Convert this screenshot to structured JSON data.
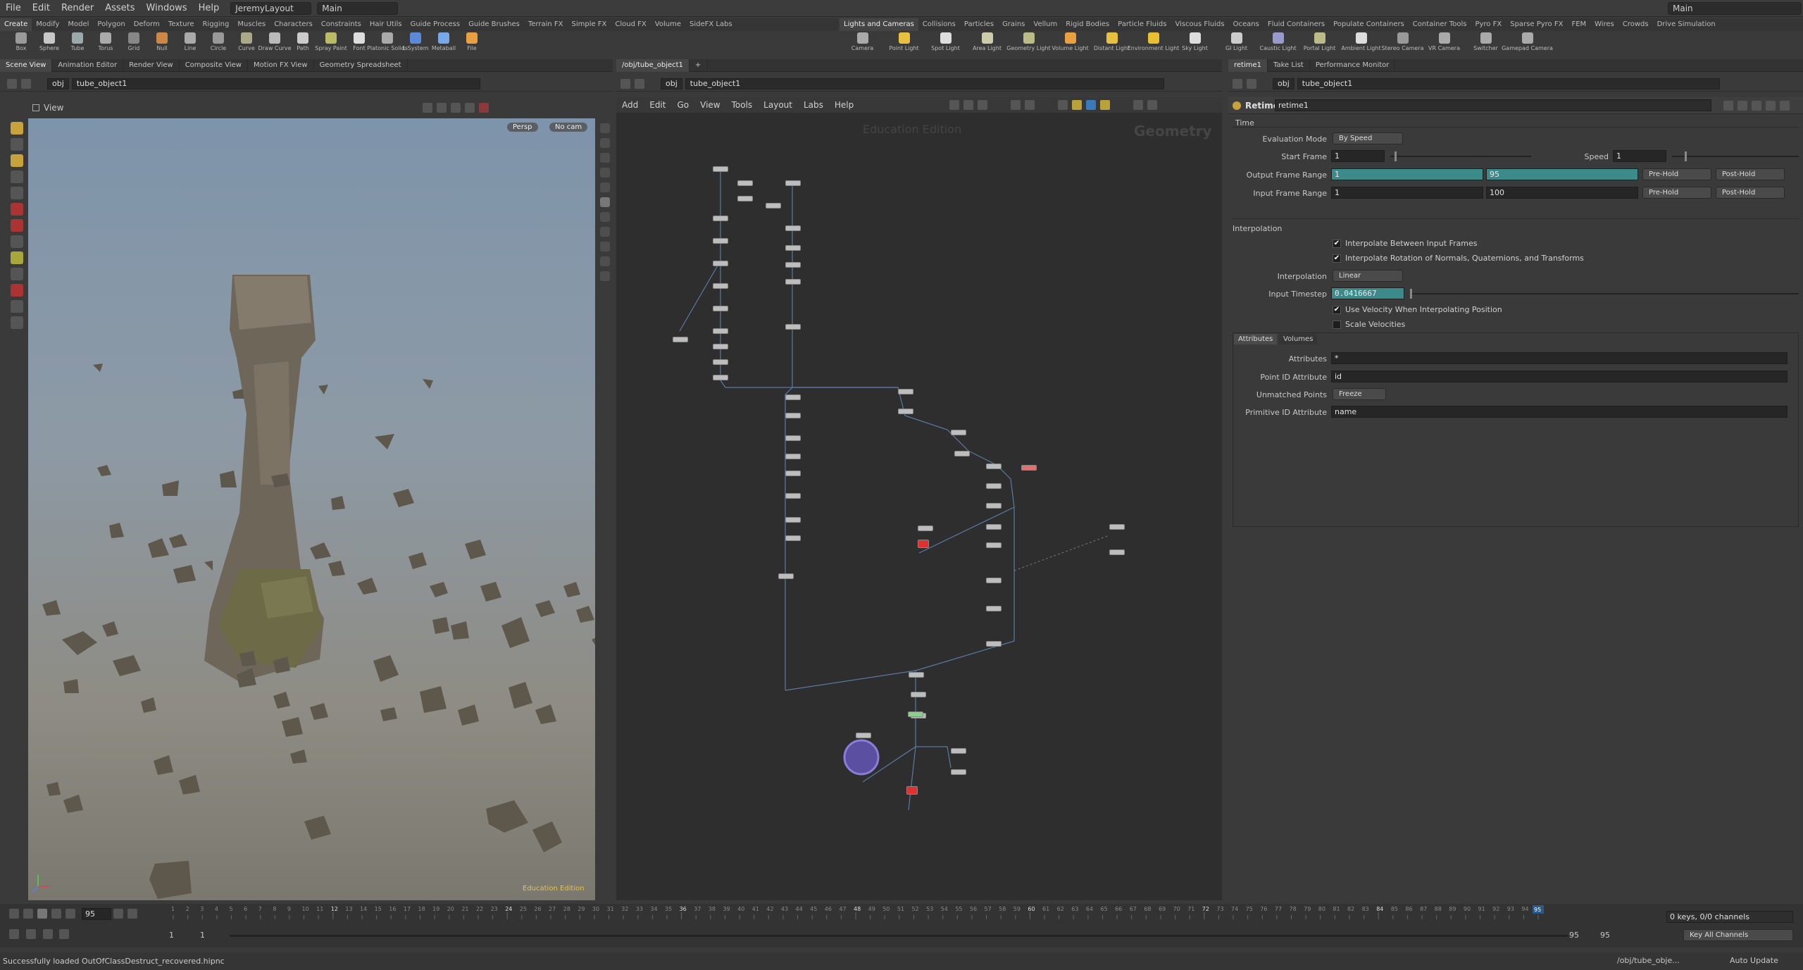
{
  "menubar": {
    "items": [
      "File",
      "Edit",
      "Render",
      "Assets",
      "Windows",
      "Help"
    ],
    "desktop": "JeremyLayout",
    "context": "Main",
    "right_context": "Main"
  },
  "shelf_left": {
    "tabs": [
      "Create",
      "Modify",
      "Model",
      "Polygon",
      "Deform",
      "Texture",
      "Rigging",
      "Muscles",
      "Characters",
      "Constraints",
      "Hair Utils",
      "Guide Process",
      "Guide Brushes",
      "Terrain FX",
      "Simple FX",
      "Cloud FX",
      "Volume",
      "SideFX Labs"
    ],
    "tools": [
      "Box",
      "Sphere",
      "Tube",
      "Torus",
      "Grid",
      "Null",
      "Line",
      "Circle",
      "Curve",
      "Draw Curve",
      "Path",
      "Spray Paint",
      "Font",
      "Platonic Solids",
      "L-System",
      "Metaball",
      "File"
    ]
  },
  "shelf_right": {
    "tabs": [
      "Lights and Cameras",
      "Collisions",
      "Particles",
      "Grains",
      "Vellum",
      "Rigid Bodies",
      "Particle Fluids",
      "Viscous Fluids",
      "Oceans",
      "Fluid Containers",
      "Populate Containers",
      "Container Tools",
      "Pyro FX",
      "Sparse Pyro FX",
      "FEM",
      "Wires",
      "Crowds",
      "Drive Simulation"
    ],
    "tools": [
      "Camera",
      "Point Light",
      "Spot Light",
      "Area Light",
      "Geometry Light",
      "Volume Light",
      "Distant Light",
      "Environment Light",
      "Sky Light",
      "GI Light",
      "Caustic Light",
      "Portal Light",
      "Ambient Light",
      "Stereo Camera",
      "VR Camera",
      "Switcher",
      "Gamepad Camera"
    ]
  },
  "left_pane": {
    "tabs": [
      "Scene View",
      "Animation Editor",
      "Render View",
      "Composite View",
      "Motion FX View",
      "Geometry Spreadsheet"
    ],
    "path_root": "obj",
    "path_node": "tube_object1",
    "view_label": "View",
    "persp": "Persp",
    "cam": "No cam",
    "watermark": "Education Edition"
  },
  "mid_pane": {
    "tab": "/obj/tube_object1",
    "path_root": "obj",
    "path_node": "tube_object1",
    "menu": [
      "Add",
      "Edit",
      "Go",
      "View",
      "Tools",
      "Layout",
      "Labs",
      "Help"
    ],
    "watermark": "Education Edition",
    "context_label": "Geometry"
  },
  "right_pane": {
    "tabs": [
      "retime1",
      "Take List",
      "Performance Monitor"
    ],
    "path_root": "obj",
    "path_node": "tube_object1",
    "node_type": "Retime",
    "node_name": "retime1",
    "time_section": "Time",
    "eval_mode_label": "Evaluation Mode",
    "eval_mode": "By Speed",
    "start_frame_label": "Start Frame",
    "start_frame": "1",
    "speed_label": "Speed",
    "speed": "1",
    "output_range_label": "Output Frame Range",
    "output_start": "1",
    "output_end": "95",
    "input_range_label": "Input Frame Range",
    "input_start": "1",
    "input_end": "100",
    "pre_hold": "Pre-Hold",
    "post_hold": "Post-Hold",
    "interp_section": "Interpolation",
    "interp_between": "Interpolate Between Input Frames",
    "interp_rotation": "Interpolate Rotation of Normals, Quaternions, and Transforms",
    "interpolation_label": "Interpolation",
    "interpolation": "Linear",
    "timestep_label": "Input Timestep",
    "timestep": "0.0416667",
    "use_velocity": "Use Velocity When Interpolating Position",
    "scale_velocities": "Scale Velocities",
    "subtabs": [
      "Attributes",
      "Volumes"
    ],
    "attributes_label": "Attributes",
    "attributes": "*",
    "point_id_label": "Point ID Attribute",
    "point_id": "id",
    "unmatched_label": "Unmatched Points",
    "unmatched": "Freeze",
    "prim_id_label": "Primitive ID Attribute",
    "prim_id": "name"
  },
  "timeline": {
    "current_frame": "95",
    "start": "1",
    "start2": "1",
    "end": "95",
    "end2": "95",
    "ruler_start": 1,
    "ruler_end": 95,
    "keys_label": "0 keys, 0/0 channels",
    "key_all": "Key All Channels"
  },
  "status": {
    "message": "Successfully loaded OutOfClassDestruct_recovered.hipnc",
    "path": "/obj/tube_obje...",
    "update": "Auto Update"
  }
}
